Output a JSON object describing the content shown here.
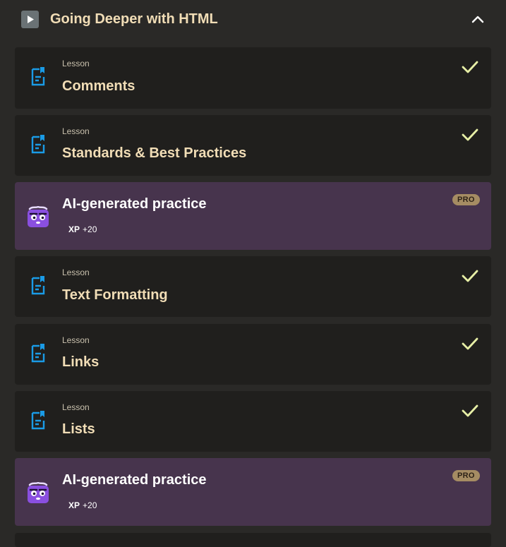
{
  "section": {
    "title": "Going Deeper with HTML",
    "icon": "play-icon",
    "toggle_icon": "chevron-up-icon"
  },
  "items": [
    {
      "kind": "lesson",
      "kicker": "Lesson",
      "title": "Comments",
      "completed": true
    },
    {
      "kind": "lesson",
      "kicker": "Lesson",
      "title": "Standards & Best Practices",
      "completed": true
    },
    {
      "kind": "ai",
      "title": "AI-generated practice",
      "xp_label": "XP",
      "xp_value": "+20",
      "badge": "PRO"
    },
    {
      "kind": "lesson",
      "kicker": "Lesson",
      "title": "Text Formatting",
      "completed": true
    },
    {
      "kind": "lesson",
      "kicker": "Lesson",
      "title": "Links",
      "completed": true
    },
    {
      "kind": "lesson",
      "kicker": "Lesson",
      "title": "Lists",
      "completed": true
    },
    {
      "kind": "ai",
      "title": "AI-generated practice",
      "xp_label": "XP",
      "xp_value": "+20",
      "badge": "PRO"
    }
  ],
  "colors": {
    "background": "#2a2927",
    "card": "#201f1d",
    "ai_card": "#47344d",
    "lesson_icon": "#1a9be6",
    "check": "#e7efa6",
    "title": "#f1ddb6",
    "pro_badge": "#a58c63"
  }
}
